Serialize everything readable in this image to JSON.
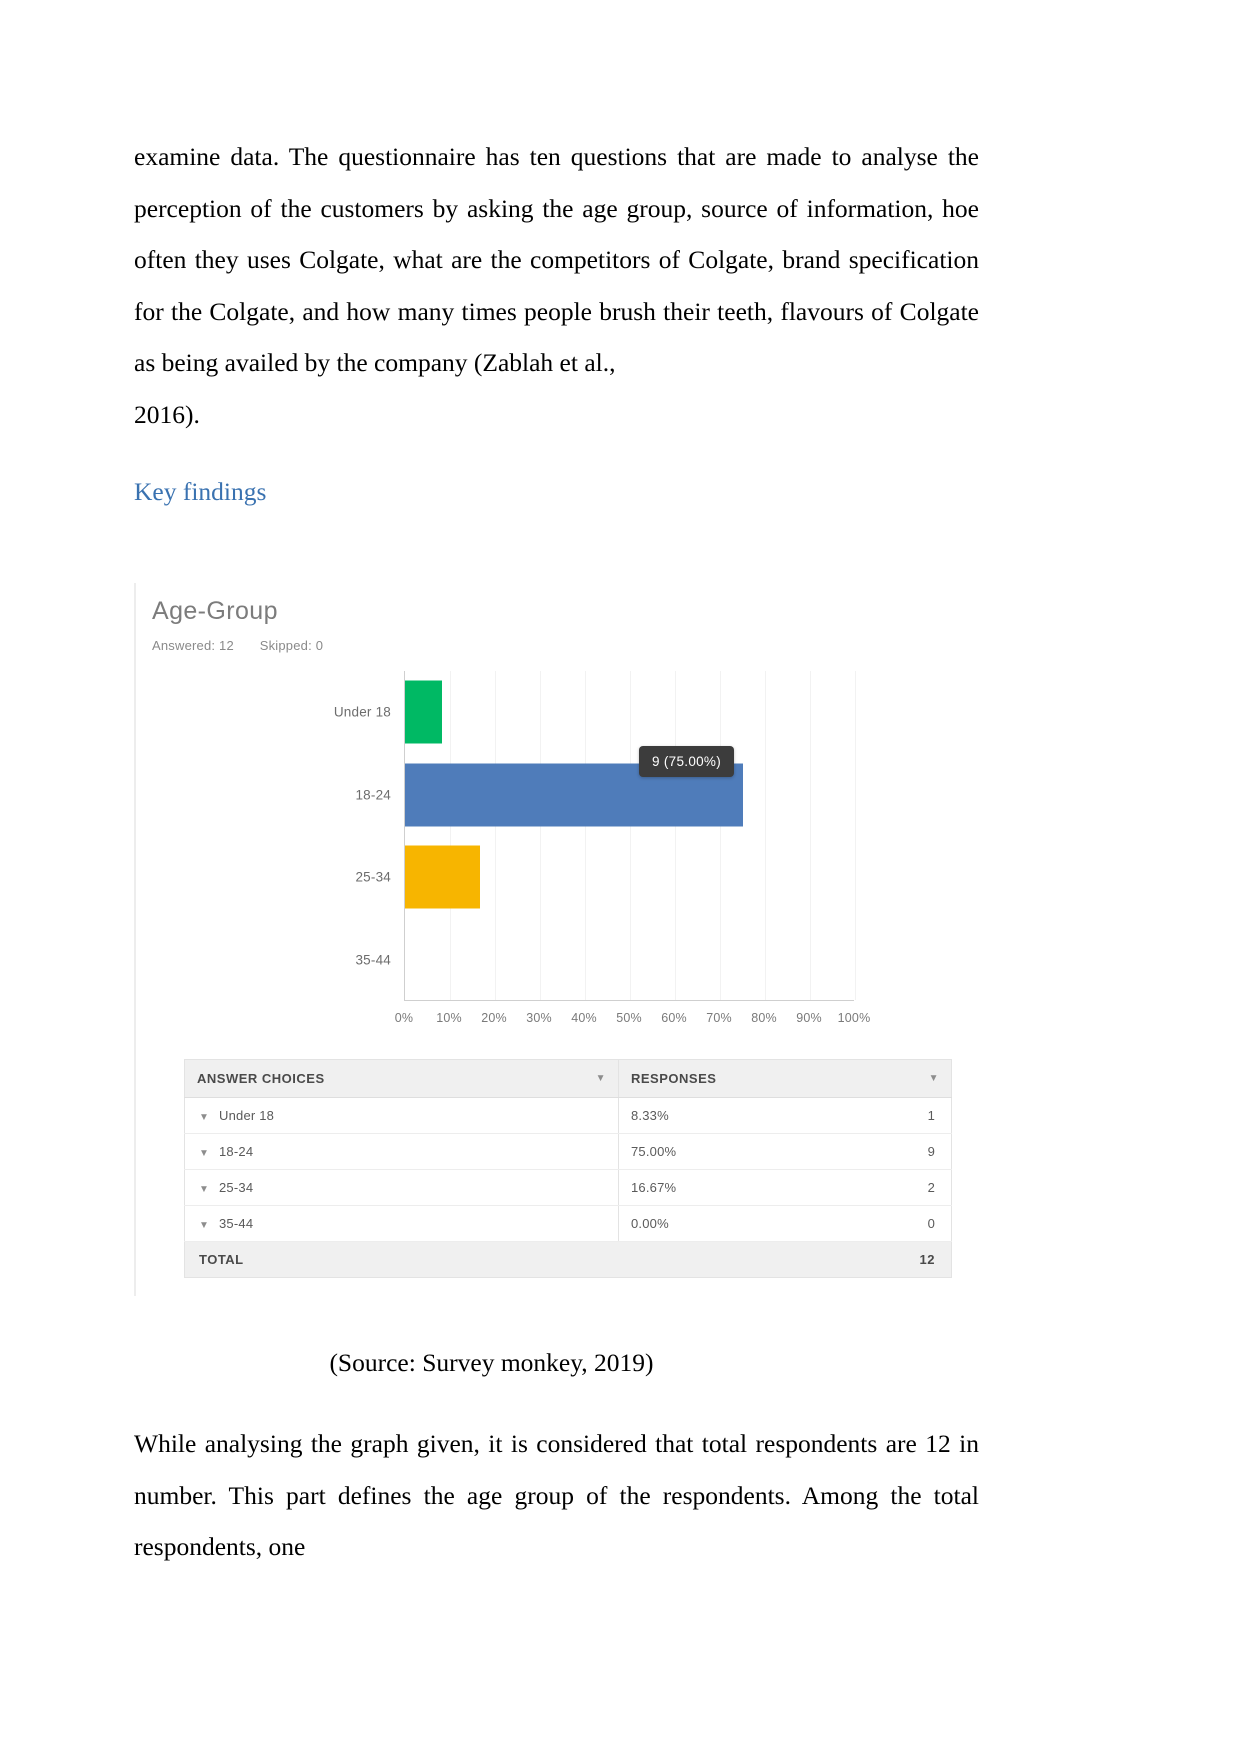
{
  "document": {
    "paragraph_1": "examine data. The questionnaire has ten questions that are made to analyse the perception of the customers by asking the age group, source of information, hoe often they uses Colgate, what are the competitors of Colgate, brand specification for the Colgate, and how many times people brush their teeth, flavours of Colgate as being availed by the company (Zablah et al.,",
    "paragraph_1_last_line": "2016).",
    "heading": "Key findings",
    "caption": "(Source: Survey monkey, 2019)",
    "paragraph_2": "While analysing the graph given, it is considered that total respondents are 12 in number. This part defines the age group of the respondents. Among the total respondents, one"
  },
  "survey": {
    "title": "Age-Group",
    "answered_label": "Answered: 12",
    "skipped_label": "Skipped: 0",
    "tooltip": "9 (75.00%)",
    "table": {
      "headers": [
        "ANSWER CHOICES",
        "RESPONSES"
      ],
      "rows": [
        {
          "choice": "Under 18",
          "percent": "8.33%",
          "count": "1"
        },
        {
          "choice": "18-24",
          "percent": "75.00%",
          "count": "9"
        },
        {
          "choice": "25-34",
          "percent": "16.67%",
          "count": "2"
        },
        {
          "choice": "35-44",
          "percent": "0.00%",
          "count": "0"
        }
      ],
      "total_label": "TOTAL",
      "total_count": "12"
    }
  },
  "chart_data": {
    "type": "bar",
    "orientation": "horizontal",
    "title": "Age-Group",
    "categories": [
      "Under 18",
      "18-24",
      "25-34",
      "35-44"
    ],
    "values": [
      8.33,
      75.0,
      16.67,
      0.0
    ],
    "counts": [
      1,
      9,
      2,
      0
    ],
    "colors": [
      "#00b964",
      "#4f7cba",
      "#f7b500",
      "#d0d0d0"
    ],
    "xlabel": "",
    "ylabel": "",
    "xlim": [
      0,
      100
    ],
    "xticks": [
      "0%",
      "10%",
      "20%",
      "30%",
      "40%",
      "50%",
      "60%",
      "70%",
      "80%",
      "90%",
      "100%"
    ],
    "grid": true,
    "legend": "none",
    "annotations": [
      "9 (75.00%)"
    ]
  },
  "colors": {
    "heading_blue": "#3a72b0",
    "bar_green": "#00b964",
    "bar_blue": "#4f7cba",
    "bar_yellow": "#f7b500",
    "tooltip_bg": "#3c3c3c",
    "table_header_bg": "#f0f0f0"
  }
}
